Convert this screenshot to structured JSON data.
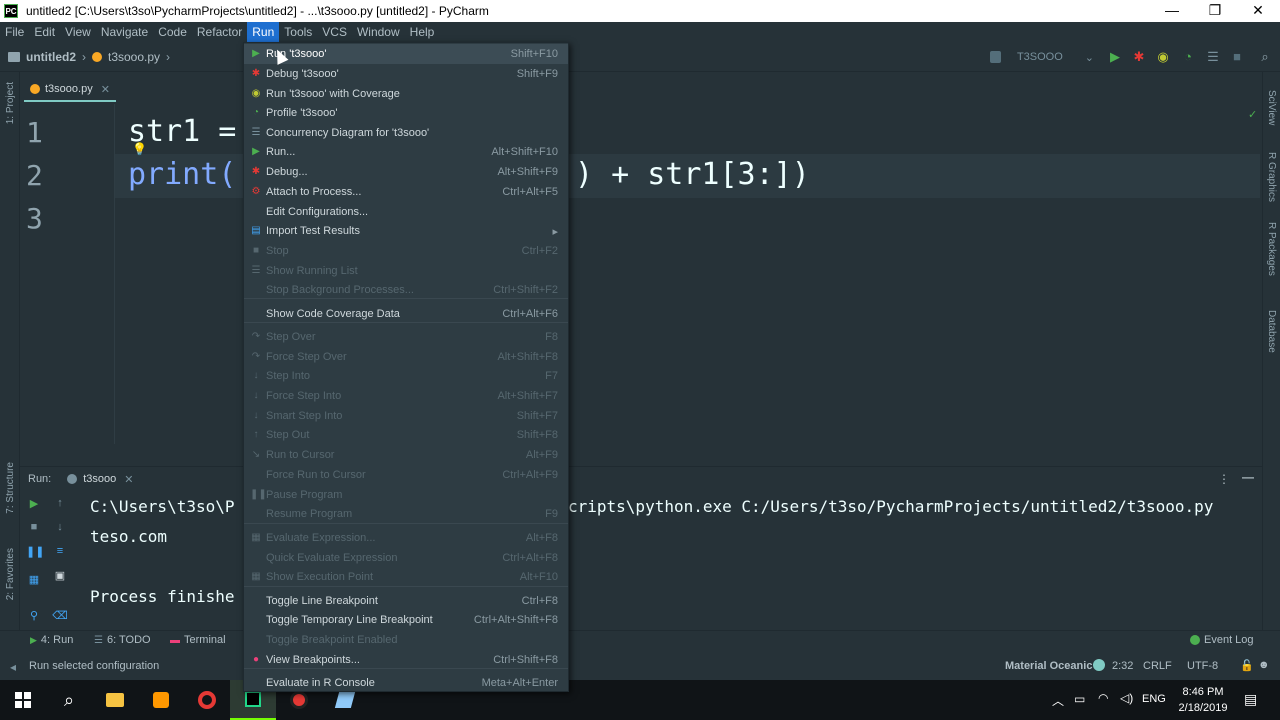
{
  "window": {
    "title": "untitled2 [C:\\Users\\t3so\\PycharmProjects\\untitled2] - ...\\t3sooo.py [untitled2] - PyCharm",
    "app_icon_text": "PC",
    "controls": [
      "—",
      "❐",
      "✕"
    ]
  },
  "menubar": {
    "items": [
      "File",
      "Edit",
      "View",
      "Navigate",
      "Code",
      "Refactor",
      "Run",
      "Tools",
      "VCS",
      "Window",
      "Help"
    ],
    "active": "Run"
  },
  "navbar": {
    "project": "untitled2",
    "file": "t3sooo.py",
    "run_config": "T3SOOO"
  },
  "editor_tab": {
    "label": "t3sooo.py"
  },
  "editor": {
    "lines": [
      {
        "num": "1",
        "code": "str1 ="
      },
      {
        "num": "2",
        "code_a": "print(",
        "code_b": ") + str1[3:])"
      },
      {
        "num": "3",
        "code": ""
      }
    ]
  },
  "left_tool_labels": [
    "1: Project",
    "7: Structure",
    "2: Favorites"
  ],
  "right_tool_labels": [
    "SciView",
    "R Graphics",
    "R Packages",
    "Database"
  ],
  "run_panel": {
    "label": "Run:",
    "tab": "t3sooo",
    "lines": [
      "C:\\Users\\t3so\\P",
      "teso.com",
      "Process finishe"
    ],
    "line1_tail": "cripts\\python.exe C:/Users/t3so/PycharmProjects/untitled2/t3sooo.py"
  },
  "bottom_tabs": [
    "4: Run",
    "6: TODO",
    "Terminal",
    "Event Log"
  ],
  "statusbar": {
    "message": "Run selected configuration",
    "theme": "Material Oceanic",
    "position": "2:32",
    "line_sep": "CRLF",
    "encoding": "UTF-8"
  },
  "taskbar": {
    "time": "8:46 PM",
    "date": "2/18/2019",
    "lang": "ENG"
  },
  "run_menu": {
    "items": [
      {
        "label": "Run 't3sooo'",
        "shortcut": "Shift+F10",
        "icon": "play-icon",
        "state": "hl"
      },
      {
        "label": "Debug 't3sooo'",
        "shortcut": "Shift+F9",
        "icon": "debug-icon",
        "state": ""
      },
      {
        "label": "Run 't3sooo' with Coverage",
        "shortcut": "",
        "icon": "coverage-icon",
        "state": ""
      },
      {
        "label": "Profile 't3sooo'",
        "shortcut": "",
        "icon": "profile-icon",
        "state": ""
      },
      {
        "label": "Concurrency Diagram for 't3sooo'",
        "shortcut": "",
        "icon": "concurrency-icon",
        "state": ""
      },
      {
        "label": "Run...",
        "shortcut": "Alt+Shift+F10",
        "icon": "play-icon",
        "state": ""
      },
      {
        "label": "Debug...",
        "shortcut": "Alt+Shift+F9",
        "icon": "debug-icon",
        "state": ""
      },
      {
        "label": "Attach to Process...",
        "shortcut": "Ctrl+Alt+F5",
        "icon": "attach-icon",
        "state": ""
      },
      {
        "label": "Edit Configurations...",
        "shortcut": "",
        "icon": "",
        "state": ""
      },
      {
        "label": "Import Test Results",
        "shortcut": "▸",
        "icon": "import-icon",
        "state": ""
      },
      {
        "label": "Stop",
        "shortcut": "Ctrl+F2",
        "icon": "stop-icon",
        "state": "dis"
      },
      {
        "label": "Show Running List",
        "shortcut": "",
        "icon": "list-icon",
        "state": "dis"
      },
      {
        "label": "Stop Background Processes...",
        "shortcut": "Ctrl+Shift+F2",
        "icon": "",
        "state": "dis"
      },
      {
        "label": "Show Code Coverage Data",
        "shortcut": "Ctrl+Alt+F6",
        "icon": "",
        "state": ""
      },
      {
        "label": "Step Over",
        "shortcut": "F8",
        "icon": "step-over-icon",
        "state": "dis"
      },
      {
        "label": "Force Step Over",
        "shortcut": "Alt+Shift+F8",
        "icon": "force-step-over-icon",
        "state": "dis"
      },
      {
        "label": "Step Into",
        "shortcut": "F7",
        "icon": "step-into-icon",
        "state": "dis"
      },
      {
        "label": "Force Step Into",
        "shortcut": "Alt+Shift+F7",
        "icon": "force-step-into-icon",
        "state": "dis"
      },
      {
        "label": "Smart Step Into",
        "shortcut": "Shift+F7",
        "icon": "smart-step-into-icon",
        "state": "dis"
      },
      {
        "label": "Step Out",
        "shortcut": "Shift+F8",
        "icon": "step-out-icon",
        "state": "dis"
      },
      {
        "label": "Run to Cursor",
        "shortcut": "Alt+F9",
        "icon": "run-to-cursor-icon",
        "state": "dis"
      },
      {
        "label": "Force Run to Cursor",
        "shortcut": "Ctrl+Alt+F9",
        "icon": "",
        "state": "dis"
      },
      {
        "label": "Pause Program",
        "shortcut": "",
        "icon": "pause-icon",
        "state": "dis"
      },
      {
        "label": "Resume Program",
        "shortcut": "F9",
        "icon": "",
        "state": "dis"
      },
      {
        "label": "Evaluate Expression...",
        "shortcut": "Alt+F8",
        "icon": "evaluate-icon",
        "state": "dis"
      },
      {
        "label": "Quick Evaluate Expression",
        "shortcut": "Ctrl+Alt+F8",
        "icon": "",
        "state": "dis"
      },
      {
        "label": "Show Execution Point",
        "shortcut": "Alt+F10",
        "icon": "exec-point-icon",
        "state": "dis"
      },
      {
        "label": "Toggle Line Breakpoint",
        "shortcut": "Ctrl+F8",
        "icon": "",
        "state": ""
      },
      {
        "label": "Toggle Temporary Line Breakpoint",
        "shortcut": "Ctrl+Alt+Shift+F8",
        "icon": "",
        "state": ""
      },
      {
        "label": "Toggle Breakpoint Enabled",
        "shortcut": "",
        "icon": "",
        "state": "dis"
      },
      {
        "label": "View Breakpoints...",
        "shortcut": "Ctrl+Shift+F8",
        "icon": "breakpoint-icon",
        "state": ""
      },
      {
        "label": "Evaluate in R Console",
        "shortcut": "Meta+Alt+Enter",
        "icon": "",
        "state": ""
      }
    ]
  },
  "colors": {
    "accent": "#1e6fd0",
    "bg": "#263238",
    "menu_bg": "#2e3c43",
    "run_green": "#4caf50",
    "debug_red": "#e53935"
  }
}
